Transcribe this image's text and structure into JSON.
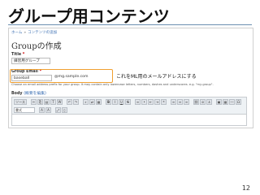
{
  "slide": {
    "title": "グループ用コンテンツ",
    "page_number": "12"
  },
  "screen": {
    "breadcrumb": [
      "ホーム",
      "コンテンツの追加"
    ],
    "heading": "Groupの作成",
    "title_field": {
      "label": "Title",
      "required_mark": "*",
      "value": "練習用グループ"
    },
    "email_field": {
      "label": "Group Email",
      "required_mark": "*",
      "value": "baseball",
      "suffix": "@mg.sample.com",
      "description": "Choose an email address prefix for your group. It may contain only lowercase letters, numbers, dashes and underscores. e.g. \"my-group\"."
    },
    "callout": "これをML用のメールアドレスにする",
    "body_field": {
      "label": "Body",
      "summary_link": "(概要を編集)"
    },
    "toolbar": {
      "source_label": "ソース",
      "format_select": "書式"
    }
  },
  "colors": {
    "highlight_border": "#f0a030",
    "link": "#3b6fb3",
    "required": "#cc0000"
  }
}
